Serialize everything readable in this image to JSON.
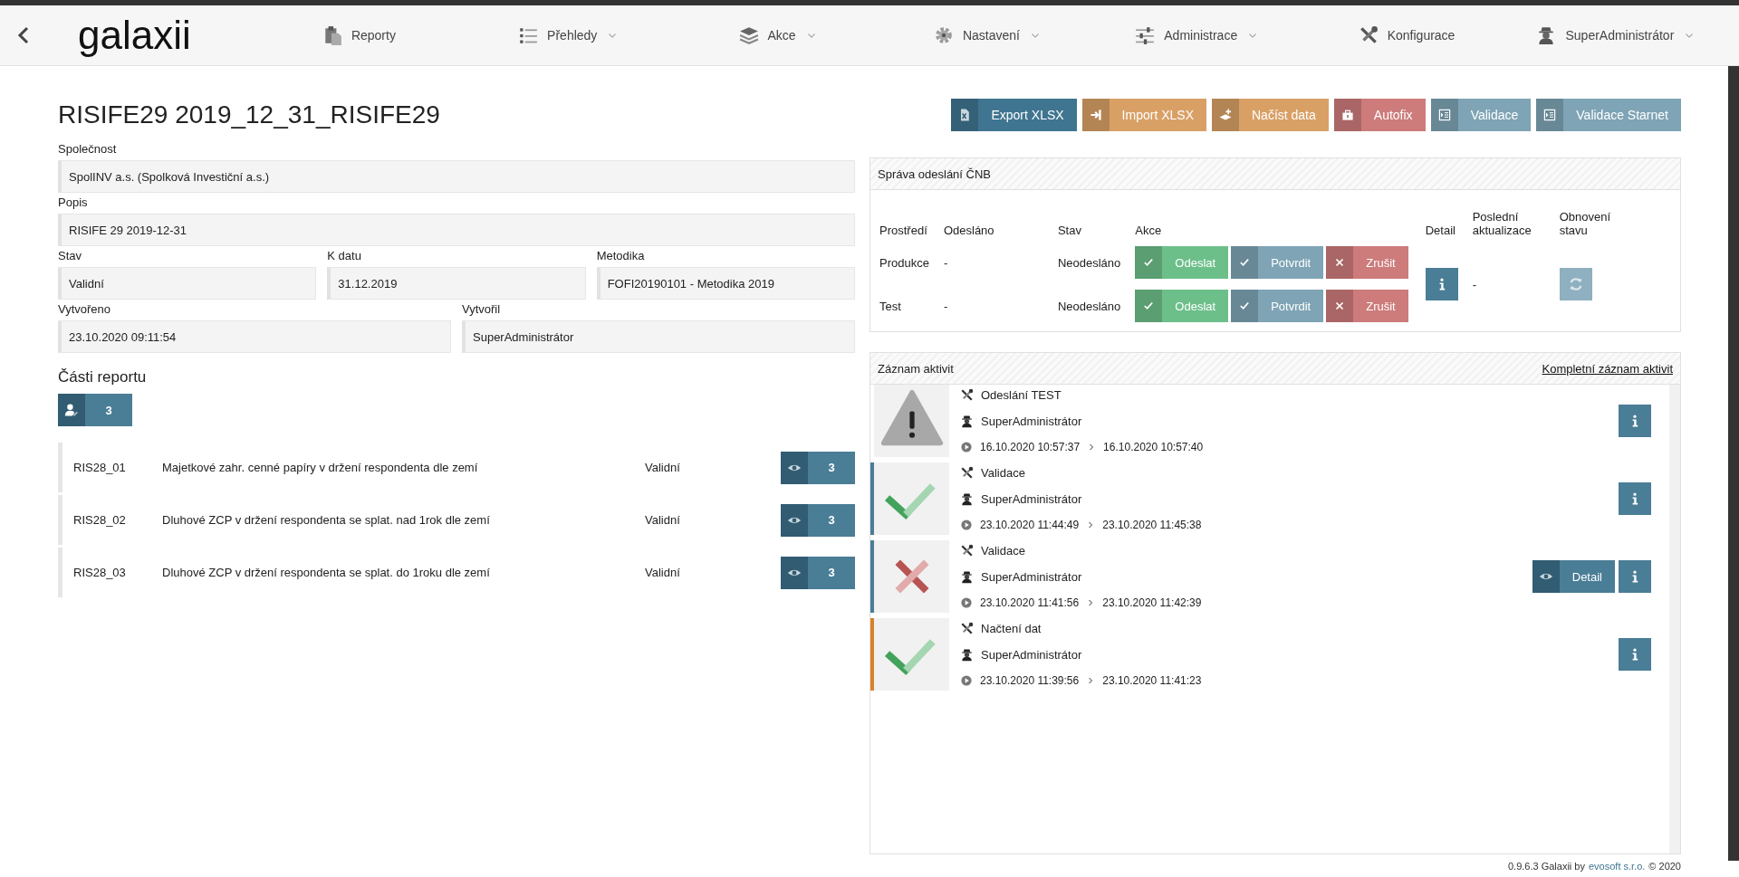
{
  "header": {
    "logo": "galaxii",
    "nav": [
      {
        "label": "Reporty",
        "dropdown": false
      },
      {
        "label": "Přehledy",
        "dropdown": true
      },
      {
        "label": "Akce",
        "dropdown": true
      },
      {
        "label": "Nastavení",
        "dropdown": true
      },
      {
        "label": "Administrace",
        "dropdown": true
      },
      {
        "label": "Konfigurace",
        "dropdown": false
      },
      {
        "label": "SuperAdministrátor",
        "dropdown": true
      }
    ]
  },
  "title": "RISIFE29 2019_12_31_RISIFE29",
  "toolbar": [
    {
      "label": "Export XLSX",
      "color": "#3f7590"
    },
    {
      "label": "Import XLSX",
      "color": "#d9a066"
    },
    {
      "label": "Načíst data",
      "color": "#d9a066"
    },
    {
      "label": "Autofix",
      "color": "#cd7b7b"
    },
    {
      "label": "Validace",
      "color": "#7ea4b5"
    },
    {
      "label": "Validace Starnet",
      "color": "#7ea4b5"
    }
  ],
  "form": {
    "rows": [
      [
        {
          "label": "Společnost",
          "value": "SpolINV a.s. (Spolková Investiční a.s.)"
        }
      ],
      [
        {
          "label": "Popis",
          "value": "RISIFE 29 2019-12-31"
        }
      ],
      [
        {
          "label": "Stav",
          "value": "Validní"
        },
        {
          "label": "K datu",
          "value": "31.12.2019"
        },
        {
          "label": "Metodika",
          "value": "FOFI20190101 - Metodika 2019"
        }
      ],
      [
        {
          "label": "Vytvořeno",
          "value": "23.10.2020 09:11:54"
        },
        {
          "label": "Vytvořil",
          "value": "SuperAdministrátor"
        }
      ]
    ]
  },
  "parts": {
    "heading": "Části reportu",
    "count": "3",
    "items": [
      {
        "code": "RIS28_01",
        "description": "Majetkové zahr. cenné papíry v držení respondenta dle zemí",
        "status": "Validní",
        "count": "3"
      },
      {
        "code": "RIS28_02",
        "description": "Dluhové ZCP v držení respondenta se splat. nad 1rok dle zemí",
        "status": "Validní",
        "count": "3"
      },
      {
        "code": "RIS28_03",
        "description": "Dluhové ZCP v držení respondenta se splat. do 1roku dle zemí",
        "status": "Validní",
        "count": "3"
      }
    ]
  },
  "cnb": {
    "title": "Správa odeslání ČNB",
    "columns": [
      "Prostředí",
      "Odesláno",
      "Stav",
      "Akce",
      "Detail",
      "Poslední aktualizace",
      "Obnovení stavu"
    ],
    "rows": [
      {
        "environment": "Produkce",
        "sent": "-",
        "state": "Neodesláno",
        "actions": [
          {
            "label": "Odeslat",
            "kind": "send"
          },
          {
            "label": "Potvrdit",
            "kind": "confirm"
          },
          {
            "label": "Zrušit",
            "kind": "cancel"
          }
        ]
      },
      {
        "environment": "Test",
        "sent": "-",
        "state": "Neodesláno",
        "actions": [
          {
            "label": "Odeslat",
            "kind": "send"
          },
          {
            "label": "Potvrdit",
            "kind": "confirm"
          },
          {
            "label": "Zrušit",
            "kind": "cancel"
          }
        ]
      }
    ],
    "last_update": "-"
  },
  "activity": {
    "title": "Záznam aktivit",
    "link": "Kompletní záznam aktivit",
    "items": [
      {
        "kind": "warning",
        "name": "Odeslání TEST",
        "user": "SuperAdministrátor",
        "start": "16.10.2020 10:57:37",
        "end": "16.10.2020 10:57:40"
      },
      {
        "kind": "success",
        "color": "#4a7d96",
        "name": "Validace",
        "user": "SuperAdministrátor",
        "start": "23.10.2020 11:44:49",
        "end": "23.10.2020 11:45:38"
      },
      {
        "kind": "error",
        "color": "#4a7d96",
        "name": "Validace",
        "user": "SuperAdministrátor",
        "start": "23.10.2020 11:41:56",
        "end": "23.10.2020 11:42:39",
        "detail": "Detail"
      },
      {
        "kind": "success",
        "color": "#d9822b",
        "name": "Načtení dat",
        "user": "SuperAdministrátor",
        "start": "23.10.2020 11:39:56",
        "end": "23.10.2020 11:41:23"
      }
    ]
  },
  "footer": {
    "version": "0.9.6.3 Galaxii by",
    "link": "evosoft s.r.o.",
    "copyright": "© 2020"
  }
}
